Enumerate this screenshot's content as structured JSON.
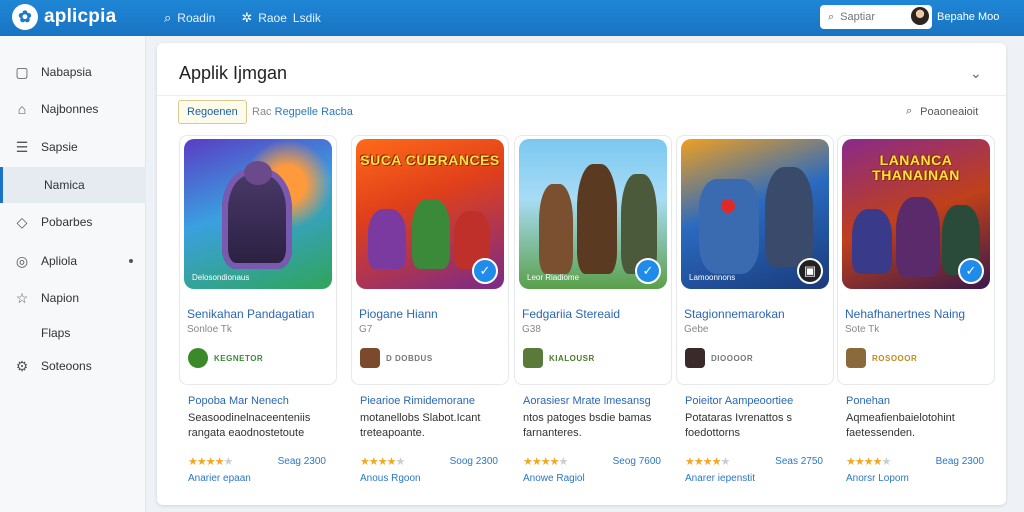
{
  "brand": {
    "name": "aplicpia",
    "mark": "✿"
  },
  "nav": {
    "item1": "Roadin",
    "item2": "Raoe",
    "item3": "Lsdik"
  },
  "search": {
    "placeholder": "Saptiar"
  },
  "user": {
    "name": "Bepahe Moo"
  },
  "sidebar": {
    "items": [
      {
        "label": "Nabapsia",
        "icon": "square-icon"
      },
      {
        "label": "Najbonnes",
        "icon": "bag-icon"
      },
      {
        "label": "Sapsie",
        "icon": "list-icon"
      },
      {
        "label": "Namica",
        "icon": "",
        "active": true
      },
      {
        "label": "Pobarbes",
        "icon": "tag-icon"
      },
      {
        "label": "Apliola",
        "icon": "compass-icon"
      },
      {
        "label": "Napion",
        "icon": "star-icon"
      },
      {
        "label": "Flaps",
        "icon": ""
      },
      {
        "label": "Soteoons",
        "icon": "gear-icon"
      }
    ]
  },
  "panel": {
    "title": "Applik Ijmgan",
    "chip": "Regoenen",
    "crumb_prefix": "Rac",
    "crumb_link": "Regpelle Racba",
    "tool_label": "Poaoneaioit"
  },
  "cards": [
    {
      "thumb_title": "",
      "thumb_caption": "Delosondionaus",
      "badge": "",
      "name": "Senikahan Pandagatian",
      "sub": "Sonloe  Tk",
      "dev": "KEGNETOR",
      "desc_title": "Popoba Mar Nenech",
      "desc_body": "Seasoodinelnaceenteniis rangata eaodnostetoute",
      "rating": 4,
      "price": "Seag  2300",
      "more": "Anarier epaan"
    },
    {
      "thumb_title": "SUCA CUBRANCES",
      "thumb_caption": "",
      "badge": "✓",
      "name": "Piogane Hiann",
      "sub": "G7",
      "dev": "D DOBDUS",
      "desc_title": "Piearioe Rimidemorane",
      "desc_body": "motanellobs Slabot.Icant treteapoante.",
      "rating": 4,
      "price": "Soog  2300",
      "more": "Anous Rgoon"
    },
    {
      "thumb_title": "",
      "thumb_caption": "Leor Riadiome",
      "badge": "✓",
      "name": "Fedgariia Stereaid",
      "sub": "G38",
      "dev": "KIALOUSR",
      "desc_title": "Aorasiesr Mrate lmesansg",
      "desc_body": "ntos patoges bsdie bamas farnanteres.",
      "rating": 4,
      "price": "Seog  7600",
      "more": "Anowe Ragiol"
    },
    {
      "thumb_title": "",
      "thumb_caption": "Lamoonnons",
      "badge": "▣",
      "name": "Stagionnemarokan",
      "sub": "Gebe",
      "dev": "DIOOOOR",
      "desc_title": "Poieitor Aampeoortiee",
      "desc_body": "Potataras Ivrenattos s foedottorns",
      "rating": 4,
      "price": "Seas  2750",
      "more": "Anarer iepenstit"
    },
    {
      "thumb_title": "LANANCA THANAINAN",
      "thumb_caption": "",
      "badge": "✓",
      "name": "Nehafhanertnes Naing",
      "sub": "Sote  Tk",
      "dev": "ROSOOOR",
      "desc_title": "Ponehan",
      "desc_body": "Aqmeafienbaielotohint faetessenden.",
      "rating": 4,
      "price": "Beag  2300",
      "more": "Anorsr Lopom"
    }
  ],
  "colors": {
    "topbar": "#1a7bcb",
    "accent": "#2a77c4",
    "star": "#f3a620"
  }
}
